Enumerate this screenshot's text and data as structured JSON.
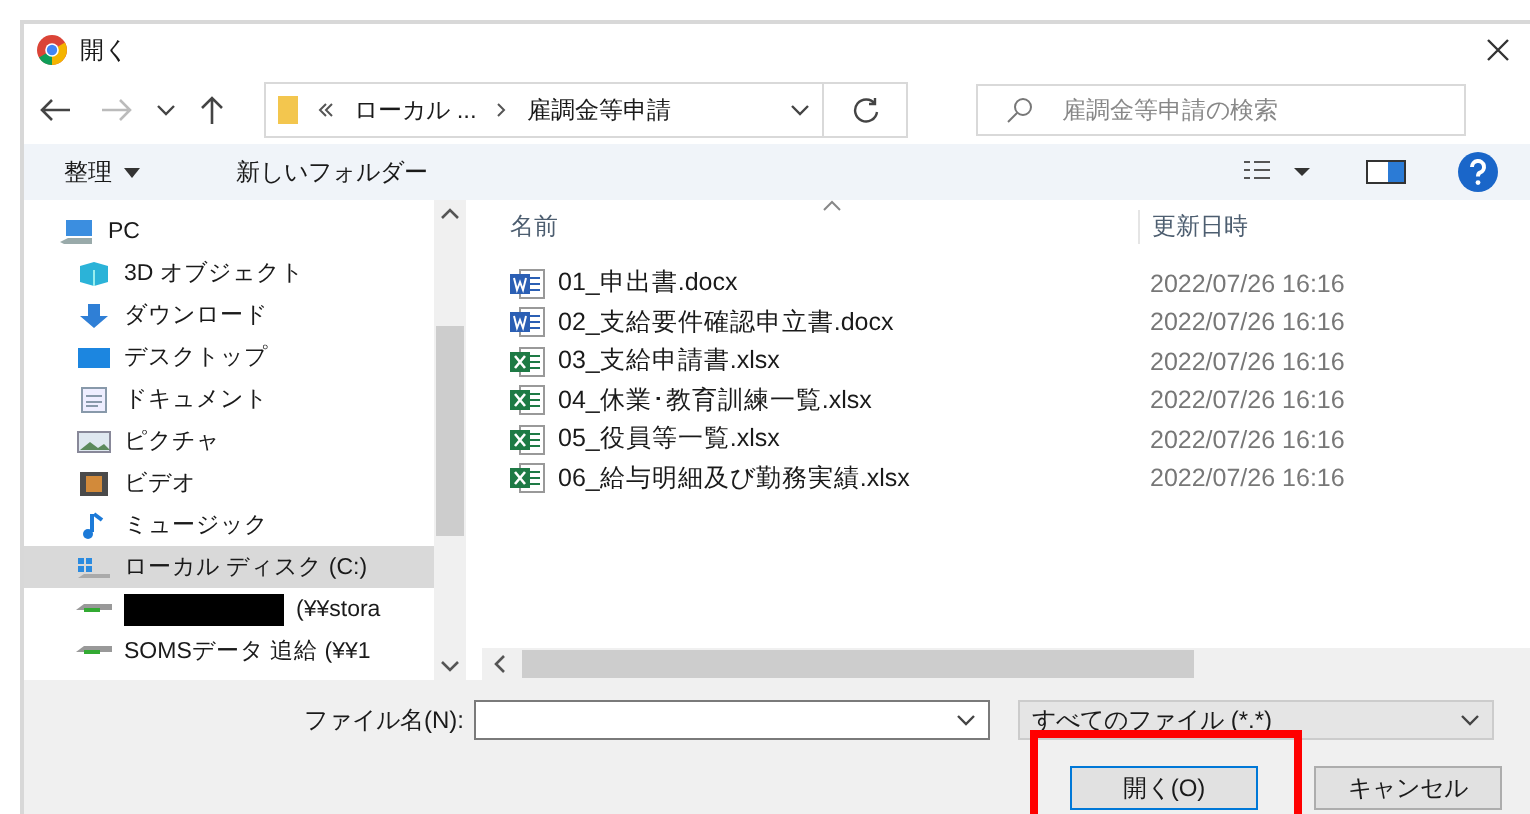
{
  "window": {
    "title": "開く"
  },
  "nav": {
    "breadcrumb": [
      {
        "label": "ローカル ..."
      },
      {
        "label": "雇調金等申請"
      }
    ],
    "search": {
      "placeholder": "雇調金等申請の検索"
    }
  },
  "toolbar": {
    "organize": "整理",
    "new_folder": "新しいフォルダー"
  },
  "tree": [
    {
      "label": "PC",
      "kind": "pc",
      "selected": false,
      "children": [
        {
          "label": "3D オブジェクト",
          "kind": "cube",
          "selected": false
        },
        {
          "label": "ダウンロード",
          "kind": "download",
          "selected": false
        },
        {
          "label": "デスクトップ",
          "kind": "desktop",
          "selected": false
        },
        {
          "label": "ドキュメント",
          "kind": "document",
          "selected": false
        },
        {
          "label": "ピクチャ",
          "kind": "picture",
          "selected": false
        },
        {
          "label": "ビデオ",
          "kind": "video",
          "selected": false
        },
        {
          "label": "ミュージック",
          "kind": "music",
          "selected": false
        },
        {
          "label": "ローカル ディスク (C:)",
          "kind": "disk",
          "selected": true
        },
        {
          "label": "(¥¥stora",
          "kind": "netdrive",
          "selected": false,
          "redacted": true
        },
        {
          "label": "SOMSデータ 追給 (¥¥1",
          "kind": "netdrive",
          "selected": false
        }
      ]
    }
  ],
  "table": {
    "columns": [
      "名前",
      "更新日時"
    ],
    "rows": [
      {
        "kind": "word",
        "name": "01_申出書.docx",
        "modified": "2022/07/26 16:16"
      },
      {
        "kind": "word",
        "name": "02_支給要件確認申立書.docx",
        "modified": "2022/07/26 16:16"
      },
      {
        "kind": "excel",
        "name": "03_支給申請書.xlsx",
        "modified": "2022/07/26 16:16"
      },
      {
        "kind": "excel",
        "name": "04_休業･教育訓練一覧.xlsx",
        "modified": "2022/07/26 16:16"
      },
      {
        "kind": "excel",
        "name": "05_役員等一覧.xlsx",
        "modified": "2022/07/26 16:16"
      },
      {
        "kind": "excel",
        "name": "06_給与明細及び勤務実績.xlsx",
        "modified": "2022/07/26 16:16"
      }
    ]
  },
  "footer": {
    "filename_label": "ファイル名(N):",
    "filetype": "すべてのファイル (*.*)",
    "open_button": {
      "label": "開く(O)",
      "highlighted": true
    },
    "cancel_button": "キャンセル"
  }
}
